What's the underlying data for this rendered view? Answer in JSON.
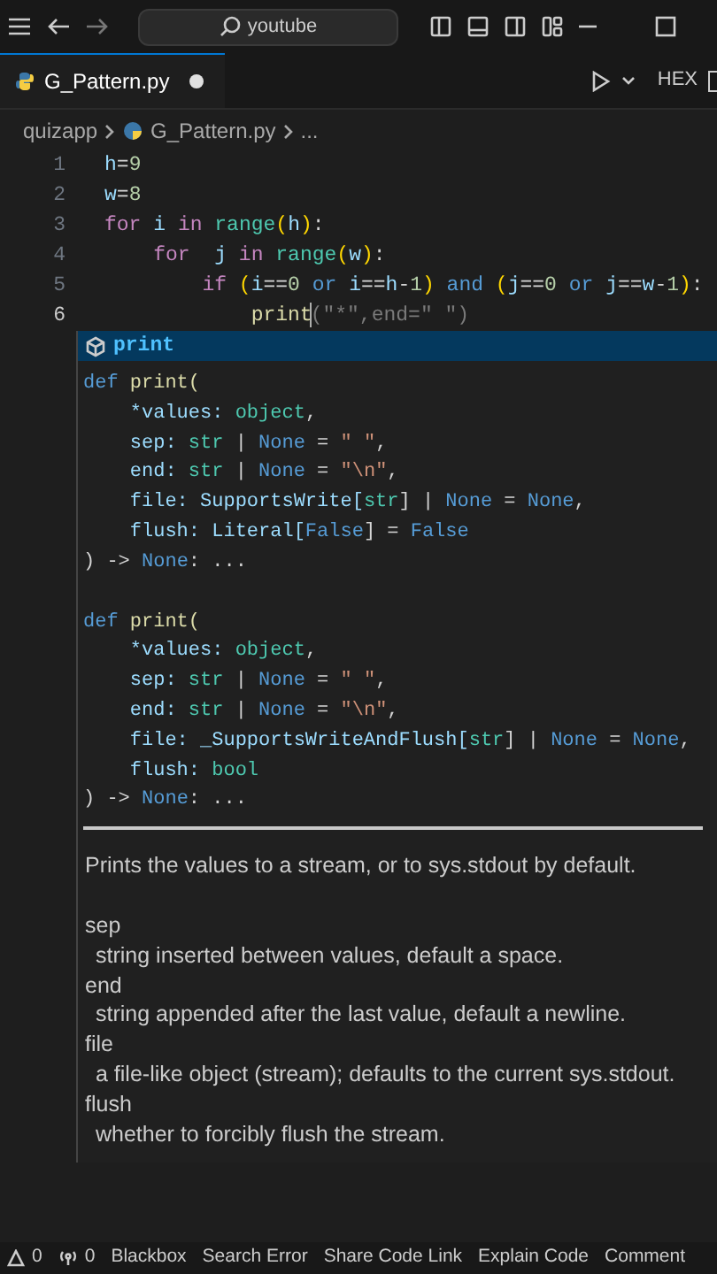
{
  "title_bar": {
    "search": {
      "value": "youtube"
    }
  },
  "tabs": [
    {
      "label": "G_Pattern.py",
      "selected": true,
      "modified": true
    }
  ],
  "editor_actions": {
    "hex": "HEX"
  },
  "breadcrumb": [
    "quizapp",
    "G_Pattern.py",
    "..."
  ],
  "code_lines": [
    {
      "number": "1",
      "current": false,
      "tokens": [
        {
          "t": "h",
          "color": "#9cdcfe"
        },
        {
          "t": "=",
          "color": "#d4d4d4"
        },
        {
          "t": "9",
          "color": "#b5cea8"
        }
      ]
    },
    {
      "number": "2",
      "current": false,
      "tokens": [
        {
          "t": "w",
          "color": "#9cdcfe"
        },
        {
          "t": "=",
          "color": "#d4d4d4"
        },
        {
          "t": "8",
          "color": "#b5cea8"
        }
      ]
    },
    {
      "number": "3",
      "current": false,
      "tokens": [
        {
          "t": "for",
          "color": "#c586c0"
        },
        {
          "t": " i ",
          "color": "#9cdcfe"
        },
        {
          "t": "in ",
          "color": "#c586c0"
        },
        {
          "t": "range",
          "color": "#4ec9b0"
        },
        {
          "t": "(",
          "color": "#ffd700"
        },
        {
          "t": "h",
          "color": "#9cdcfe"
        },
        {
          "t": ")",
          "color": "#ffd700"
        },
        {
          "t": ":",
          "color": "#d4d4d4"
        }
      ]
    },
    {
      "number": "4",
      "current": false,
      "tokens": [
        {
          "t": "    for",
          "color": "#c586c0"
        },
        {
          "t": "  j ",
          "color": "#9cdcfe"
        },
        {
          "t": "in ",
          "color": "#c586c0"
        },
        {
          "t": "range",
          "color": "#4ec9b0"
        },
        {
          "t": "(",
          "color": "#ffd700"
        },
        {
          "t": "w",
          "color": "#9cdcfe"
        },
        {
          "t": ")",
          "color": "#ffd700"
        },
        {
          "t": ":",
          "color": "#d4d4d4"
        }
      ]
    },
    {
      "number": "5",
      "current": false,
      "tokens": [
        {
          "t": "        if ",
          "color": "#c586c0"
        },
        {
          "t": "(",
          "color": "#ffd700"
        },
        {
          "t": "i",
          "color": "#9cdcfe"
        },
        {
          "t": "==",
          "color": "#d4d4d4"
        },
        {
          "t": "0",
          "color": "#b5cea8"
        },
        {
          "t": " or ",
          "color": "#569cd6"
        },
        {
          "t": "i",
          "color": "#9cdcfe"
        },
        {
          "t": "==",
          "color": "#d4d4d4"
        },
        {
          "t": "h",
          "color": "#9cdcfe"
        },
        {
          "t": "-",
          "color": "#d4d4d4"
        },
        {
          "t": "1",
          "color": "#b5cea8"
        },
        {
          "t": ")",
          "color": "#ffd700"
        },
        {
          "t": " and ",
          "color": "#569cd6"
        },
        {
          "t": "(",
          "color": "#ffd700"
        },
        {
          "t": "j",
          "color": "#9cdcfe"
        },
        {
          "t": "==",
          "color": "#d4d4d4"
        },
        {
          "t": "0",
          "color": "#b5cea8"
        },
        {
          "t": " or ",
          "color": "#569cd6"
        },
        {
          "t": "j",
          "color": "#9cdcfe"
        },
        {
          "t": "==",
          "color": "#d4d4d4"
        },
        {
          "t": "w",
          "color": "#9cdcfe"
        },
        {
          "t": "-",
          "color": "#d4d4d4"
        },
        {
          "t": "1",
          "color": "#b5cea8"
        },
        {
          "t": ")",
          "color": "#ffd700"
        },
        {
          "t": ":",
          "color": "#d4d4d4"
        }
      ]
    },
    {
      "number": "6",
      "current": true,
      "tokens": [
        {
          "t": "            print",
          "color": "#dcdcaa"
        },
        {
          "t": "(\"*\",end=\" \")",
          "color": "#7a7a7a"
        }
      ]
    }
  ],
  "suggestion": {
    "label": "print",
    "selected": true
  },
  "signatures": [
    [
      [
        {
          "t": "def ",
          "color": "#569cd6"
        },
        {
          "t": "print(",
          "color": "#dcdcaa"
        }
      ],
      [
        {
          "t": "    *values: ",
          "color": "#9cdcfe"
        },
        {
          "t": "object",
          "color": "#4ec9b0"
        },
        {
          "t": ",",
          "color": "#d4d4d4"
        }
      ],
      [
        {
          "t": "    sep: ",
          "color": "#9cdcfe"
        },
        {
          "t": "str",
          "color": "#4ec9b0"
        },
        {
          "t": " | ",
          "color": "#d4d4d4"
        },
        {
          "t": "None",
          "color": "#569cd6"
        },
        {
          "t": " = ",
          "color": "#d4d4d4"
        },
        {
          "t": "\" \"",
          "color": "#ce9178"
        },
        {
          "t": ",",
          "color": "#d4d4d4"
        }
      ],
      [
        {
          "t": "    end: ",
          "color": "#9cdcfe"
        },
        {
          "t": "str",
          "color": "#4ec9b0"
        },
        {
          "t": " | ",
          "color": "#d4d4d4"
        },
        {
          "t": "None",
          "color": "#569cd6"
        },
        {
          "t": " = ",
          "color": "#d4d4d4"
        },
        {
          "t": "\"\\n\"",
          "color": "#ce9178"
        },
        {
          "t": ",",
          "color": "#d4d4d4"
        }
      ],
      [
        {
          "t": "    file: SupportsWrite[",
          "color": "#9cdcfe"
        },
        {
          "t": "str",
          "color": "#4ec9b0"
        },
        {
          "t": "] | ",
          "color": "#d4d4d4"
        },
        {
          "t": "None",
          "color": "#569cd6"
        },
        {
          "t": " = ",
          "color": "#d4d4d4"
        },
        {
          "t": "None",
          "color": "#569cd6"
        },
        {
          "t": ",",
          "color": "#d4d4d4"
        }
      ],
      [
        {
          "t": "    flush: Literal[",
          "color": "#9cdcfe"
        },
        {
          "t": "False",
          "color": "#569cd6"
        },
        {
          "t": "] = ",
          "color": "#d4d4d4"
        },
        {
          "t": "False",
          "color": "#569cd6"
        }
      ],
      [
        {
          "t": ") -> ",
          "color": "#d4d4d4"
        },
        {
          "t": "None",
          "color": "#569cd6"
        },
        {
          "t": ": ...",
          "color": "#d4d4d4"
        }
      ]
    ],
    [
      [
        {
          "t": "def ",
          "color": "#569cd6"
        },
        {
          "t": "print(",
          "color": "#dcdcaa"
        }
      ],
      [
        {
          "t": "    *values: ",
          "color": "#9cdcfe"
        },
        {
          "t": "object",
          "color": "#4ec9b0"
        },
        {
          "t": ",",
          "color": "#d4d4d4"
        }
      ],
      [
        {
          "t": "    sep: ",
          "color": "#9cdcfe"
        },
        {
          "t": "str",
          "color": "#4ec9b0"
        },
        {
          "t": " | ",
          "color": "#d4d4d4"
        },
        {
          "t": "None",
          "color": "#569cd6"
        },
        {
          "t": " = ",
          "color": "#d4d4d4"
        },
        {
          "t": "\" \"",
          "color": "#ce9178"
        },
        {
          "t": ",",
          "color": "#d4d4d4"
        }
      ],
      [
        {
          "t": "    end: ",
          "color": "#9cdcfe"
        },
        {
          "t": "str",
          "color": "#4ec9b0"
        },
        {
          "t": " | ",
          "color": "#d4d4d4"
        },
        {
          "t": "None",
          "color": "#569cd6"
        },
        {
          "t": " = ",
          "color": "#d4d4d4"
        },
        {
          "t": "\"\\n\"",
          "color": "#ce9178"
        },
        {
          "t": ",",
          "color": "#d4d4d4"
        }
      ],
      [
        {
          "t": "    file: _SupportsWriteAndFlush[",
          "color": "#9cdcfe"
        },
        {
          "t": "str",
          "color": "#4ec9b0"
        },
        {
          "t": "] | ",
          "color": "#d4d4d4"
        },
        {
          "t": "None",
          "color": "#569cd6"
        },
        {
          "t": " = ",
          "color": "#d4d4d4"
        },
        {
          "t": "None",
          "color": "#569cd6"
        },
        {
          "t": ",",
          "color": "#d4d4d4"
        }
      ],
      [
        {
          "t": "    flush: ",
          "color": "#9cdcfe"
        },
        {
          "t": "bool",
          "color": "#4ec9b0"
        }
      ],
      [
        {
          "t": ") -> ",
          "color": "#d4d4d4"
        },
        {
          "t": "None",
          "color": "#569cd6"
        },
        {
          "t": ": ...",
          "color": "#d4d4d4"
        }
      ]
    ]
  ],
  "doc": {
    "summary": "Prints the values to a stream, or to sys.stdout by default.",
    "params": [
      {
        "name": "sep",
        "text": "string inserted between values, default a space."
      },
      {
        "name": "end",
        "text": "string appended after the last value, default a newline."
      },
      {
        "name": "file",
        "text": "a file-like object (stream); defaults to the current sys.stdout."
      },
      {
        "name": "flush",
        "text": "whether to forcibly flush the stream."
      }
    ]
  },
  "status_bar": [
    {
      "kind": "warnings",
      "text": "0"
    },
    {
      "kind": "ports",
      "text": "0"
    },
    {
      "kind": "item",
      "text": "Blackbox"
    },
    {
      "kind": "item",
      "text": "Search Error"
    },
    {
      "kind": "item",
      "text": "Share Code Link"
    },
    {
      "kind": "item",
      "text": "Explain Code"
    },
    {
      "kind": "item",
      "text": "Comment"
    }
  ]
}
